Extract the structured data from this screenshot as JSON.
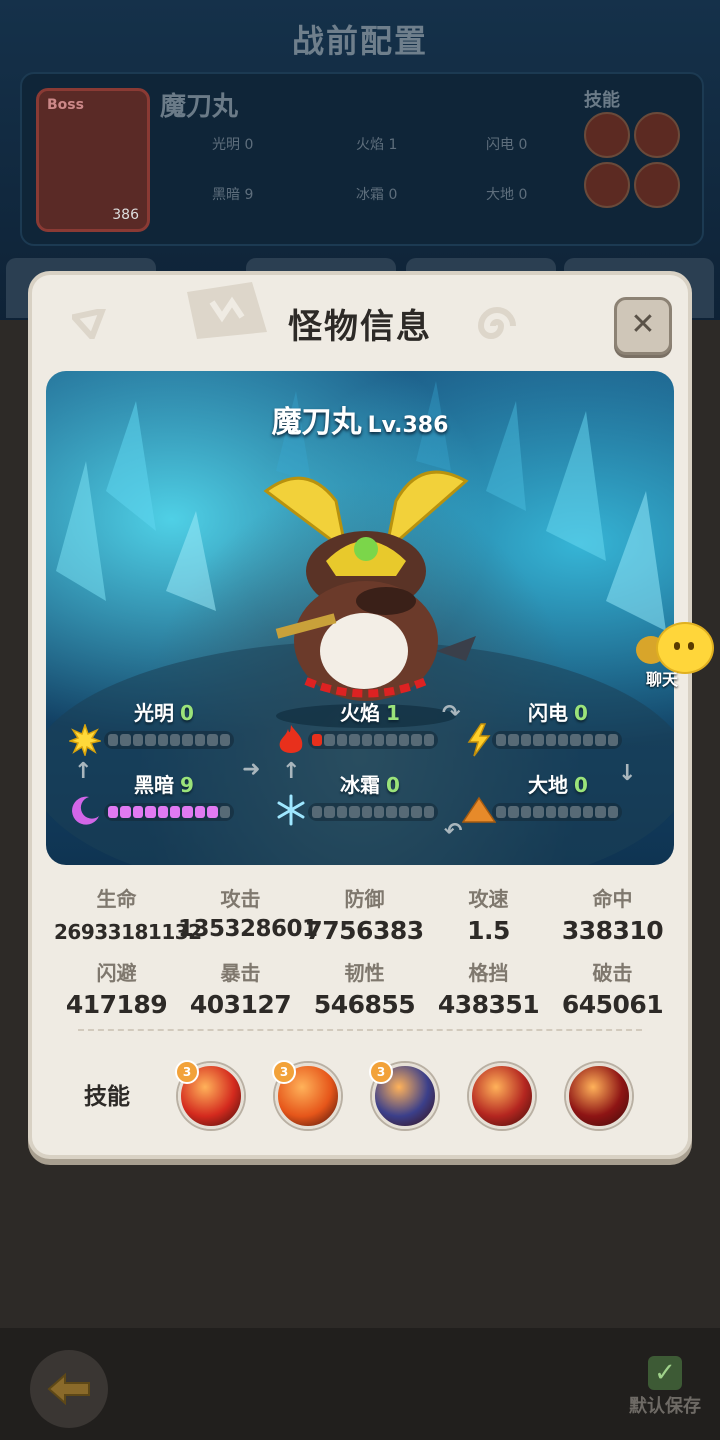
{
  "background": {
    "title": "战前配置",
    "boss_tag": "Boss",
    "boss_level": "386",
    "monster_name": "魔刀丸",
    "skills_label": "技能",
    "elements": [
      {
        "name": "光明",
        "value": "0"
      },
      {
        "name": "火焰",
        "value": "1"
      },
      {
        "name": "闪电",
        "value": "0"
      },
      {
        "name": "黑暗",
        "value": "9"
      },
      {
        "name": "冰霜",
        "value": "0"
      },
      {
        "name": "大地",
        "value": "0"
      }
    ]
  },
  "modal": {
    "title": "怪物信息",
    "close_symbol": "✕",
    "monster_name": "魔刀丸",
    "monster_level": "Lv.386",
    "elements": [
      {
        "name": "光明",
        "value": "0",
        "filled": 0,
        "icon": "sun-icon"
      },
      {
        "name": "火焰",
        "value": "1",
        "filled": 1,
        "icon": "fire-icon"
      },
      {
        "name": "闪电",
        "value": "0",
        "filled": 0,
        "icon": "lightning-icon"
      },
      {
        "name": "黑暗",
        "value": "9",
        "filled": 9,
        "icon": "moon-icon"
      },
      {
        "name": "冰霜",
        "value": "0",
        "filled": 0,
        "icon": "snowflake-icon"
      },
      {
        "name": "大地",
        "value": "0",
        "filled": 0,
        "icon": "earth-icon"
      }
    ],
    "stats": [
      {
        "label": "生命",
        "value": "26933181132"
      },
      {
        "label": "攻击",
        "value": "135328601"
      },
      {
        "label": "防御",
        "value": "7756383"
      },
      {
        "label": "攻速",
        "value": "1.5"
      },
      {
        "label": "命中",
        "value": "338310"
      },
      {
        "label": "闪避",
        "value": "417189"
      },
      {
        "label": "暴击",
        "value": "403127"
      },
      {
        "label": "韧性",
        "value": "546855"
      },
      {
        "label": "格挡",
        "value": "438351"
      },
      {
        "label": "破击",
        "value": "645061"
      }
    ],
    "skills_label": "技能",
    "skills": [
      {
        "icon": "sword-strike-skill-icon",
        "badge": "3",
        "color": "#d42a1e"
      },
      {
        "icon": "fire-tornado-skill-icon",
        "badge": "3",
        "color": "#e6561a"
      },
      {
        "icon": "dark-cloud-skill-icon",
        "badge": "3",
        "color": "#3b3f8a"
      },
      {
        "icon": "demon-warrior-skill-icon",
        "badge": "",
        "color": "#b42620"
      },
      {
        "icon": "blade-slash-skill-icon",
        "badge": "",
        "color": "#8e1414"
      }
    ]
  },
  "chat": {
    "label": "聊天"
  },
  "footer": {
    "save_label": "默认保存"
  }
}
